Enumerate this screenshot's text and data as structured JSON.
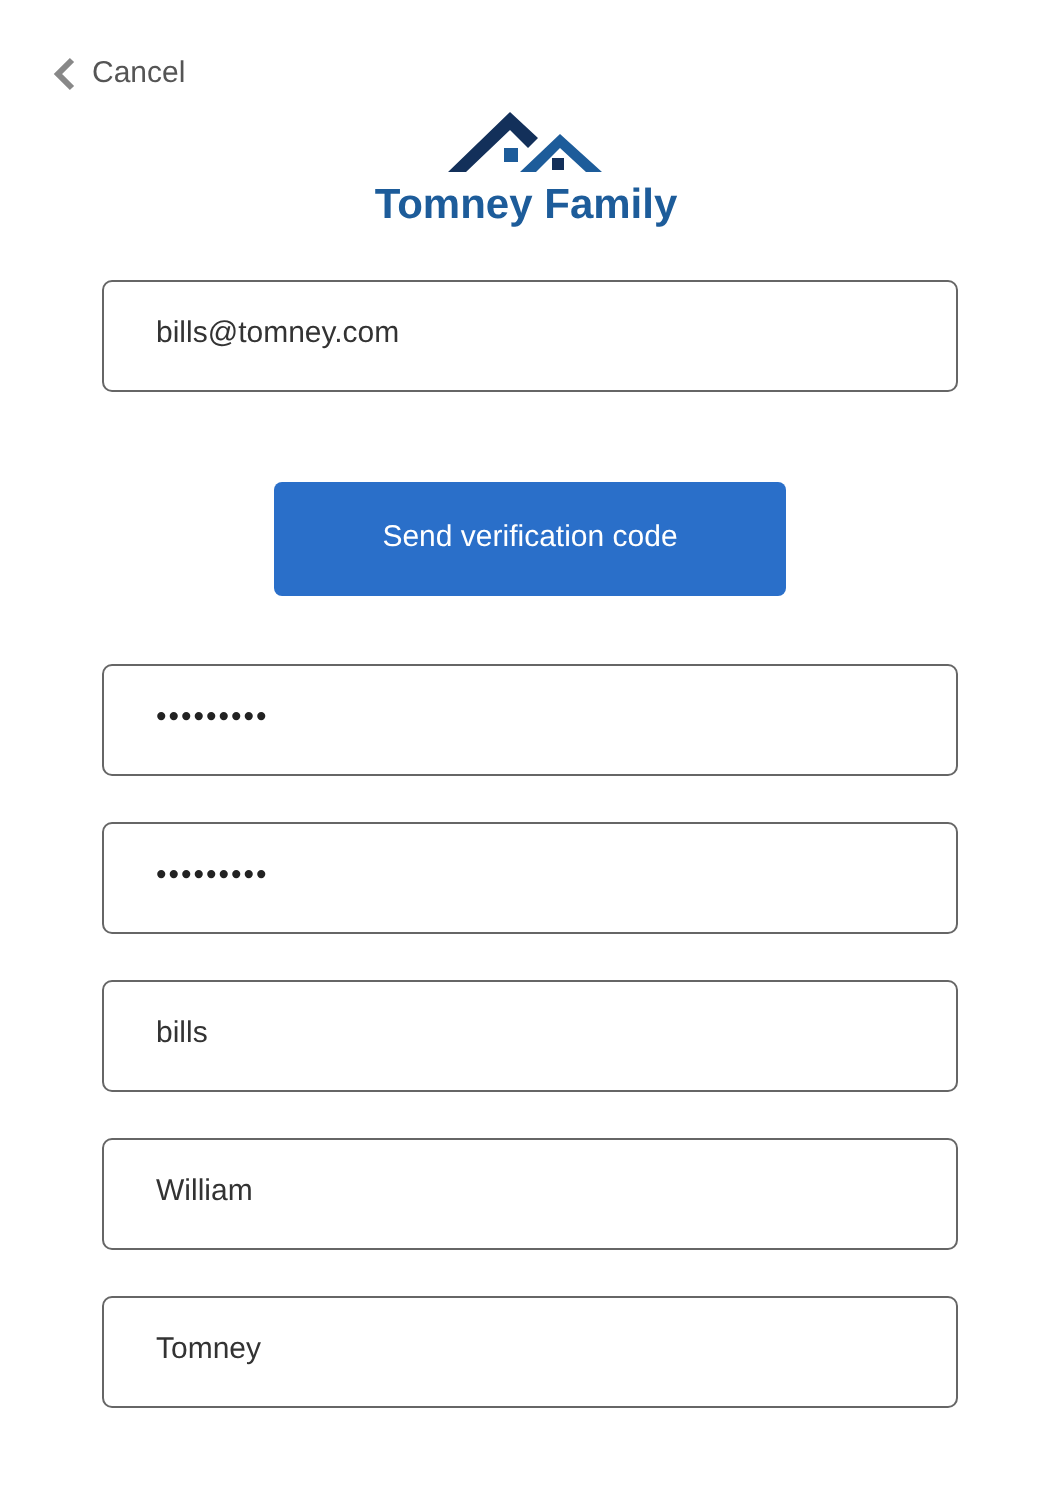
{
  "cancel": {
    "label": "Cancel"
  },
  "logo": {
    "title": "Tomney Family"
  },
  "email": {
    "value": "bills@tomney.com"
  },
  "send_button": {
    "label": "Send verification code"
  },
  "fields": [
    {
      "kind": "password",
      "value": "•••••••••"
    },
    {
      "kind": "password",
      "value": "•••••••••"
    },
    {
      "kind": "text",
      "value": "bills"
    },
    {
      "kind": "text",
      "value": "William"
    },
    {
      "kind": "text",
      "value": "Tomney"
    }
  ]
}
